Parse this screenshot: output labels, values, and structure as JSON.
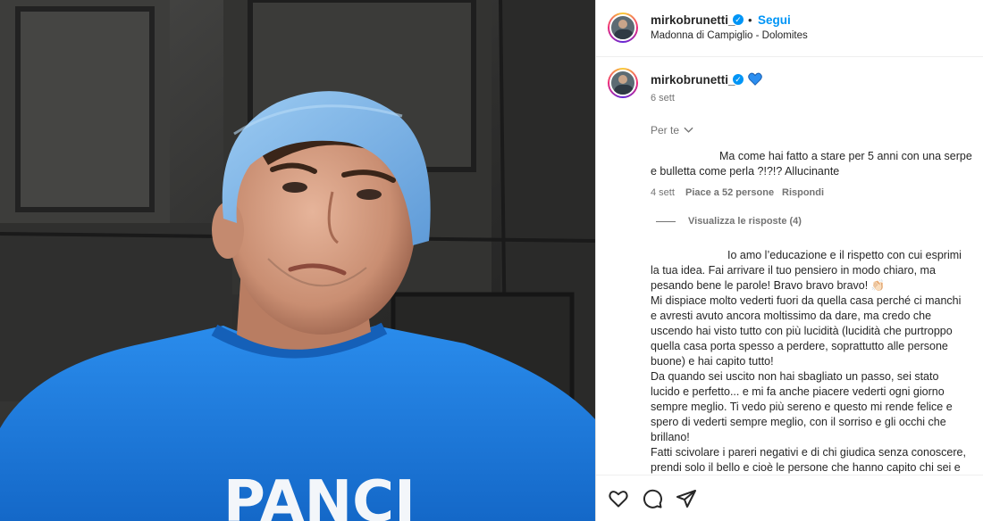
{
  "post": {
    "username": "mirkobrunetti_",
    "follow_label": "Segui",
    "separator": "•",
    "location": "Madonna di Campiglio - Dolomites"
  },
  "caption": {
    "username": "mirkobrunetti_",
    "emoji_icon": "blue-heart-icon",
    "date": "6 sett"
  },
  "filter": {
    "label": "Per te",
    "icon": "chevron-down-icon"
  },
  "comment1": {
    "text": "Ma come hai fatto a stare per 5 anni con una serpe e bulletta come perla ?!?!? Allucinante",
    "date": "4 sett",
    "likes": "Piace a 52 persone",
    "reply": "Rispondi",
    "view_replies": "Visualizza le risposte (4)"
  },
  "comment2": {
    "lines": [
      "Io amo l’educazione e il rispetto con cui esprimi",
      "la tua idea. Fai arrivare il tuo pensiero in modo chiaro, ma",
      "pesando bene le parole! Bravo bravo bravo! 👏🏻",
      "Mi dispiace molto vederti fuori da quella casa perché ci manchi",
      "e avresti avuto ancora moltissimo da dare, ma credo che",
      "uscendo hai visto tutto con più lucidità (lucidità che purtroppo",
      "quella casa porta spesso a perdere, soprattutto alle persone",
      "buone) e hai capito tutto!",
      "Da quando sei uscito non hai sbagliato un passo, sei stato",
      "lucido e perfetto... e mi fa anche piacere vederti ogni giorno",
      "sempre meglio. Ti vedo più sereno e questo mi rende felice e",
      "spero di vederti sempre meglio, con il sorriso e gli occhi che",
      "brillano!",
      "Fatti scivolare i pareri negativi e di chi giudica senza conoscere,",
      "prendi solo il bello e cioè le persone che hanno capito chi sei e"
    ]
  },
  "photo": {
    "sweater_text": "PANCI"
  },
  "actions": {
    "icons": [
      "heart-icon",
      "comment-icon",
      "share-icon"
    ]
  },
  "colors": {
    "accent": "#0095f6",
    "sweater": "#1f7fe0",
    "beanie": "#7fb6e8"
  }
}
